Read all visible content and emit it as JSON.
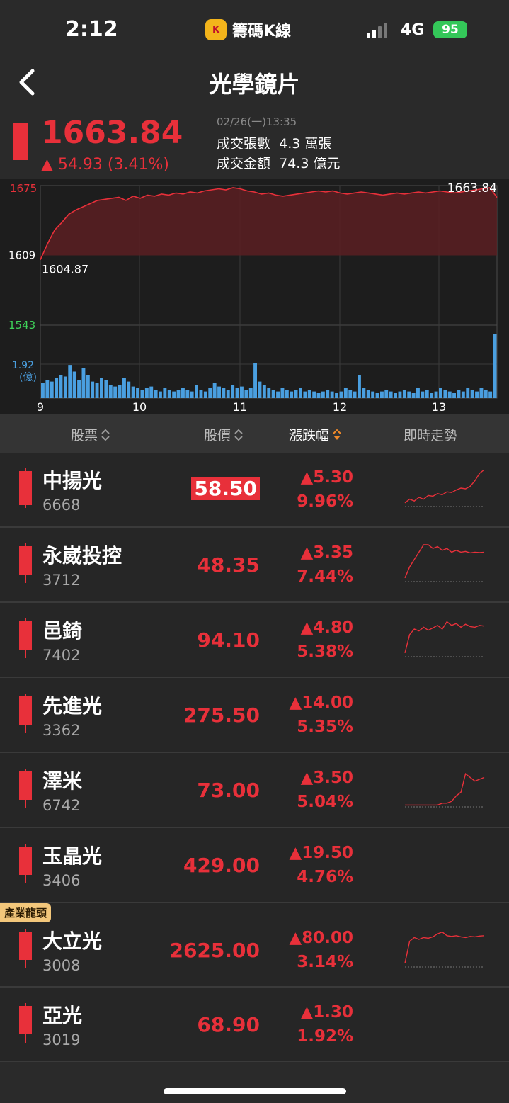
{
  "status_bar": {
    "time": "2:12",
    "app_icon_text": "K",
    "app_name": "籌碼K線",
    "network": "4G",
    "battery": "95"
  },
  "nav": {
    "title": "光學鏡片",
    "back_icon": "chevron-left-icon"
  },
  "index": {
    "price": "1663.84",
    "change": "▲ 54.93 (3.41%)",
    "datetime": "02/26(一)13:35",
    "volume_label": "成交張數",
    "volume_value": "4.3 萬張",
    "amount_label": "成交金額",
    "amount_value": "74.3 億元"
  },
  "colors": {
    "up": "#e8303a",
    "down": "#3fd35a",
    "volume": "#4a9fe0",
    "background": "#262626"
  },
  "chart_data": {
    "type": "line",
    "price_axis": {
      "top": "1675",
      "mid": "1609",
      "bottom": "1543"
    },
    "reference_price": 1609,
    "low_label": "1604.87",
    "last_label": "1663.84",
    "volume_axis_label": "1.92",
    "volume_unit": "(億)",
    "x_ticks": [
      "9",
      "10",
      "11",
      "12",
      "13"
    ],
    "price_series": [
      1604.87,
      1620,
      1633,
      1640,
      1648,
      1652,
      1655,
      1658,
      1661,
      1662,
      1663,
      1664,
      1661,
      1665,
      1663,
      1666,
      1665,
      1667,
      1666,
      1668,
      1667,
      1669,
      1668,
      1670,
      1671,
      1672,
      1671,
      1673,
      1672,
      1670,
      1669,
      1667,
      1668,
      1666,
      1665,
      1666,
      1667,
      1668,
      1669,
      1670,
      1669,
      1670,
      1668,
      1667,
      1668,
      1669,
      1668,
      1667,
      1666,
      1667,
      1668,
      1667,
      1668,
      1669,
      1668,
      1669,
      1670,
      1669,
      1668,
      1669,
      1670,
      1671,
      1672,
      1673,
      1663.84
    ],
    "volume_series": [
      0.45,
      0.55,
      0.5,
      0.6,
      0.7,
      0.65,
      1.0,
      0.8,
      0.55,
      0.9,
      0.7,
      0.5,
      0.45,
      0.6,
      0.55,
      0.4,
      0.35,
      0.4,
      0.6,
      0.5,
      0.35,
      0.3,
      0.25,
      0.3,
      0.35,
      0.25,
      0.2,
      0.3,
      0.25,
      0.2,
      0.25,
      0.3,
      0.25,
      0.2,
      0.4,
      0.25,
      0.2,
      0.3,
      0.45,
      0.35,
      0.3,
      0.25,
      0.4,
      0.3,
      0.35,
      0.25,
      0.3,
      1.05,
      0.5,
      0.4,
      0.3,
      0.25,
      0.2,
      0.3,
      0.25,
      0.2,
      0.25,
      0.3,
      0.2,
      0.25,
      0.2,
      0.15,
      0.2,
      0.25,
      0.2,
      0.15,
      0.2,
      0.3,
      0.25,
      0.2,
      0.7,
      0.3,
      0.25,
      0.2,
      0.15,
      0.2,
      0.25,
      0.2,
      0.15,
      0.2,
      0.25,
      0.2,
      0.15,
      0.3,
      0.2,
      0.25,
      0.15,
      0.2,
      0.3,
      0.25,
      0.2,
      0.15,
      0.25,
      0.2,
      0.3,
      0.25,
      0.2,
      0.3,
      0.25,
      0.2,
      1.92
    ]
  },
  "table": {
    "headers": {
      "stock": "股票",
      "price": "股價",
      "change": "漲跌幅",
      "trend": "即時走勢"
    },
    "rows": [
      {
        "name": "中揚光",
        "code": "6668",
        "price": "58.50",
        "change": "▲5.30",
        "pct": "9.96%",
        "highlight": true,
        "badge": "",
        "spark": [
          0.1,
          0.2,
          0.15,
          0.25,
          0.2,
          0.3,
          0.28,
          0.35,
          0.32,
          0.4,
          0.38,
          0.45,
          0.5,
          0.48,
          0.55,
          0.7,
          0.9,
          1.0
        ]
      },
      {
        "name": "永崴投控",
        "code": "3712",
        "price": "48.35",
        "change": "▲3.35",
        "pct": "7.44%",
        "highlight": false,
        "badge": "",
        "spark": [
          0.1,
          0.4,
          0.6,
          0.8,
          1.0,
          1.0,
          0.9,
          0.95,
          0.85,
          0.9,
          0.8,
          0.85,
          0.8,
          0.82,
          0.78,
          0.8,
          0.79,
          0.8
        ]
      },
      {
        "name": "邑錡",
        "code": "7402",
        "price": "94.10",
        "change": "▲4.80",
        "pct": "5.38%",
        "highlight": false,
        "badge": "",
        "spark": [
          0.1,
          0.6,
          0.75,
          0.7,
          0.8,
          0.72,
          0.78,
          0.85,
          0.75,
          0.95,
          0.85,
          0.9,
          0.8,
          0.88,
          0.82,
          0.8,
          0.85,
          0.83
        ]
      },
      {
        "name": "先進光",
        "code": "3362",
        "price": "275.50",
        "change": "▲14.00",
        "pct": "5.35%",
        "highlight": false,
        "badge": "",
        "spark": []
      },
      {
        "name": "澤米",
        "code": "6742",
        "price": "73.00",
        "change": "▲3.50",
        "pct": "5.04%",
        "highlight": false,
        "badge": "",
        "spark": [
          0.05,
          0.05,
          0.05,
          0.05,
          0.05,
          0.05,
          0.05,
          0.05,
          0.1,
          0.1,
          0.15,
          0.3,
          0.4,
          0.9,
          0.8,
          0.7,
          0.75,
          0.8
        ]
      },
      {
        "name": "玉晶光",
        "code": "3406",
        "price": "429.00",
        "change": "▲19.50",
        "pct": "4.76%",
        "highlight": false,
        "badge": "",
        "spark": []
      },
      {
        "name": "大立光",
        "code": "3008",
        "price": "2625.00",
        "change": "▲80.00",
        "pct": "3.14%",
        "highlight": false,
        "badge": "產業龍頭",
        "spark": [
          0.1,
          0.7,
          0.8,
          0.75,
          0.8,
          0.78,
          0.82,
          0.9,
          0.95,
          0.85,
          0.83,
          0.85,
          0.82,
          0.8,
          0.83,
          0.82,
          0.84,
          0.85
        ]
      },
      {
        "name": "亞光",
        "code": "3019",
        "price": "68.90",
        "change": "▲1.30",
        "pct": "1.92%",
        "highlight": false,
        "badge": "",
        "spark": []
      }
    ]
  }
}
